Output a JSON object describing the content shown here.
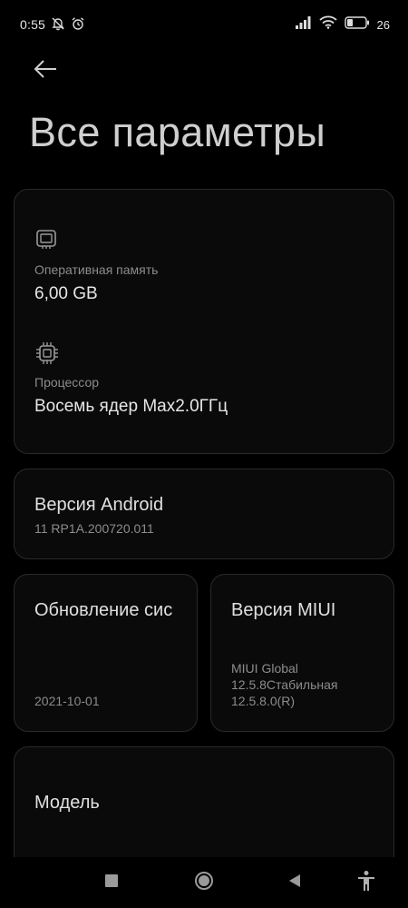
{
  "status_bar": {
    "time": "0:55",
    "battery": "26"
  },
  "page": {
    "title": "Все параметры"
  },
  "specs": {
    "ram_label": "Оперативная память",
    "ram_value": "6,00 GB",
    "cpu_label": "Процессор",
    "cpu_value": "Восемь ядер Max2.0ГГц"
  },
  "android": {
    "title": "Версия Android",
    "value": "11 RP1A.200720.011"
  },
  "system_update": {
    "title": "Обновление сис",
    "date": "2021-10-01"
  },
  "miui": {
    "title": "Версия MIUI",
    "line1": "MIUI Global",
    "line2": "12.5.8Стабильная",
    "line3": "12.5.8.0(R)"
  },
  "model": {
    "title": "Модель"
  },
  "icons": {
    "status": [
      "dnd-off-icon",
      "alarm-icon",
      "signal-icon",
      "wifi-icon",
      "battery-icon"
    ],
    "nav": [
      "recents-icon",
      "home-icon",
      "back-icon",
      "accessibility-icon"
    ]
  }
}
